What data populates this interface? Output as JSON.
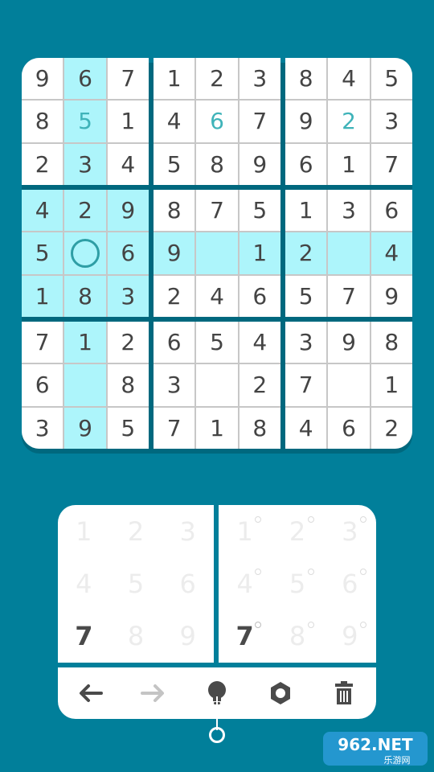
{
  "board": {
    "boxes": [
      {
        "cells": [
          {
            "v": "9"
          },
          {
            "v": "6",
            "hl": true
          },
          {
            "v": "7"
          },
          {
            "v": "8"
          },
          {
            "v": "5",
            "hl": true,
            "accent": true
          },
          {
            "v": "1"
          },
          {
            "v": "2"
          },
          {
            "v": "3",
            "hl": true
          },
          {
            "v": "4"
          }
        ]
      },
      {
        "cells": [
          {
            "v": "1"
          },
          {
            "v": "2"
          },
          {
            "v": "3"
          },
          {
            "v": "4"
          },
          {
            "v": "6",
            "accent": true
          },
          {
            "v": "7"
          },
          {
            "v": "5"
          },
          {
            "v": "8"
          },
          {
            "v": "9"
          }
        ]
      },
      {
        "cells": [
          {
            "v": "8"
          },
          {
            "v": "4"
          },
          {
            "v": "5"
          },
          {
            "v": "9"
          },
          {
            "v": "2",
            "accent": true
          },
          {
            "v": "3"
          },
          {
            "v": "6"
          },
          {
            "v": "1"
          },
          {
            "v": "7"
          }
        ]
      },
      {
        "cells": [
          {
            "v": "4",
            "hl": true
          },
          {
            "v": "2",
            "hl": true
          },
          {
            "v": "9",
            "hl": true
          },
          {
            "v": "5",
            "hl": true
          },
          {
            "v": "",
            "hl": true,
            "selected": true
          },
          {
            "v": "6",
            "hl": true
          },
          {
            "v": "1",
            "hl": true
          },
          {
            "v": "8",
            "hl": true
          },
          {
            "v": "3",
            "hl": true
          }
        ]
      },
      {
        "cells": [
          {
            "v": "8"
          },
          {
            "v": "7"
          },
          {
            "v": "5"
          },
          {
            "v": "9",
            "hl": true
          },
          {
            "v": "",
            "hl": true
          },
          {
            "v": "1",
            "hl": true
          },
          {
            "v": "2"
          },
          {
            "v": "4"
          },
          {
            "v": "6"
          }
        ]
      },
      {
        "cells": [
          {
            "v": "1"
          },
          {
            "v": "3"
          },
          {
            "v": "6"
          },
          {
            "v": "2",
            "hl": true
          },
          {
            "v": "",
            "hl": true
          },
          {
            "v": "4",
            "hl": true
          },
          {
            "v": "5"
          },
          {
            "v": "7"
          },
          {
            "v": "9"
          }
        ]
      },
      {
        "cells": [
          {
            "v": "7"
          },
          {
            "v": "1",
            "hl": true
          },
          {
            "v": "2"
          },
          {
            "v": "6"
          },
          {
            "v": "",
            "hl": true
          },
          {
            "v": "8"
          },
          {
            "v": "3"
          },
          {
            "v": "9",
            "hl": true
          },
          {
            "v": "5"
          }
        ]
      },
      {
        "cells": [
          {
            "v": "6"
          },
          {
            "v": "5"
          },
          {
            "v": "4"
          },
          {
            "v": "3"
          },
          {
            "v": ""
          },
          {
            "v": "2"
          },
          {
            "v": "7"
          },
          {
            "v": "1"
          },
          {
            "v": "8"
          }
        ]
      },
      {
        "cells": [
          {
            "v": "3"
          },
          {
            "v": "9"
          },
          {
            "v": "8"
          },
          {
            "v": "7"
          },
          {
            "v": ""
          },
          {
            "v": "1"
          },
          {
            "v": "4"
          },
          {
            "v": "6"
          },
          {
            "v": "2"
          }
        ]
      }
    ]
  },
  "keypad": {
    "numbers": [
      "1",
      "2",
      "3",
      "4",
      "5",
      "6",
      "7",
      "8",
      "9"
    ],
    "active": "7"
  },
  "toolbar": {
    "tools": [
      {
        "name": "undo-button",
        "icon": "arrow-left-icon",
        "enabled": true
      },
      {
        "name": "redo-button",
        "icon": "arrow-right-icon",
        "enabled": false
      },
      {
        "name": "hint-button",
        "icon": "lightbulb-icon",
        "enabled": true
      },
      {
        "name": "settings-button",
        "icon": "gear-icon",
        "enabled": true
      },
      {
        "name": "delete-button",
        "icon": "trash-icon",
        "enabled": true
      }
    ]
  },
  "watermark": {
    "brand": "962.NET",
    "subtitle": "乐游网"
  },
  "colors": {
    "background": "#017f9a",
    "highlight": "#adf5fb",
    "accent": "#3fb3b9",
    "digit": "#444444"
  }
}
